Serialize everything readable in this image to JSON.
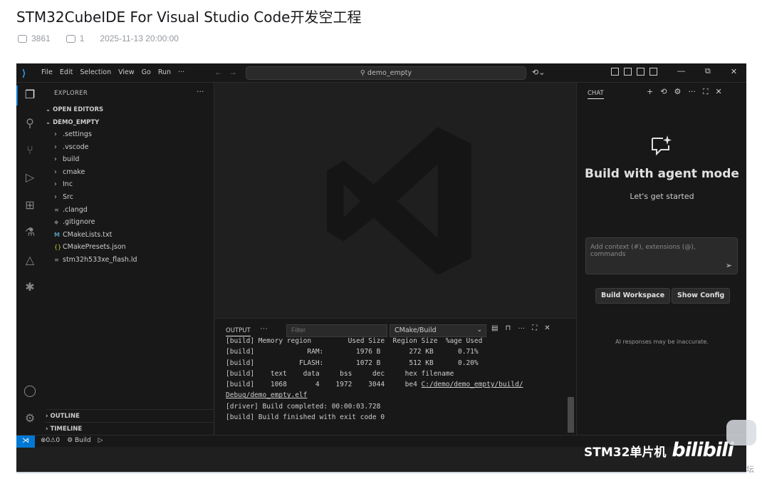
{
  "page": {
    "title": "STM32CubeIDE For Visual Studio Code开发空工程",
    "views": "3861",
    "comments": "1",
    "date": "2025-11-13 20:00:00",
    "forum_suffix": "坛"
  },
  "vscode": {
    "menu": [
      "File",
      "Edit",
      "Selection",
      "View",
      "Go",
      "Run",
      "···"
    ],
    "command_center": "demo_empty",
    "explorer": {
      "header": "EXPLORER",
      "more": "···",
      "open_editors": "OPEN EDITORS",
      "project": "DEMO_EMPTY",
      "items": [
        {
          "chev": "›",
          "icon": "",
          "label": ".settings"
        },
        {
          "chev": "›",
          "icon": "",
          "label": ".vscode"
        },
        {
          "chev": "›",
          "icon": "",
          "label": "build"
        },
        {
          "chev": "›",
          "icon": "",
          "label": "cmake"
        },
        {
          "chev": "›",
          "icon": "",
          "label": "Inc"
        },
        {
          "chev": "›",
          "icon": "",
          "label": "Src"
        },
        {
          "chev": "",
          "icon": "≡",
          "label": ".clangd"
        },
        {
          "chev": "",
          "icon": "◆",
          "label": ".gitignore"
        },
        {
          "chev": "",
          "icon": "M",
          "label": "CMakeLists.txt"
        },
        {
          "chev": "",
          "icon": "{}",
          "label": "CMakePresets.json"
        },
        {
          "chev": "",
          "icon": "≡",
          "label": "stm32h533xe_flash.ld"
        }
      ],
      "outline": "OUTLINE",
      "timeline": "TIMELINE"
    },
    "panel": {
      "tab": "OUTPUT",
      "more": "···",
      "filter_placeholder": "Filter",
      "channel": "CMake/Build",
      "lines": [
        "[build] Memory region         Used Size  Region Size  %age Used",
        "[build]             RAM:        1976 B       272 KB      0.71%",
        "[build]           FLASH:        1072 B       512 KB      0.20%",
        "[build]    text    data     bss     dec     hex filename",
        "[build]    1068       4    1972    3044     be4 "
      ],
      "path_a": "C:/demo/demo_empty/build/",
      "path_b": "Debug/demo_empty.elf",
      "tail": [
        "[driver] Build completed: 00:00:03.728",
        "[build] Build finished with exit code 0"
      ]
    },
    "chat": {
      "tab": "CHAT",
      "heading": "Build with agent mode",
      "subheading": "Let's get started",
      "input_placeholder": "Add context (#), extensions (@), commands",
      "button_build": "Build Workspace",
      "button_config": "Show Config",
      "note": "AI responses may be inaccurate."
    },
    "status": {
      "problems": "⊗0⚠0",
      "build": "⚙ Build",
      "run": "▷"
    }
  },
  "brand": {
    "channel": "STM32单片机",
    "logo": "bilibili"
  },
  "colors": {
    "accent": "#0078d4",
    "editor_bg": "#1f1f1f",
    "sidebar_bg": "#181818"
  }
}
